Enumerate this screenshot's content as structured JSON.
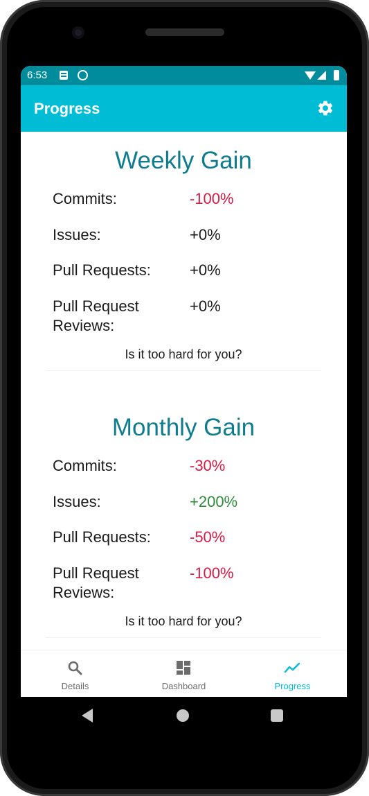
{
  "status_bar": {
    "time": "6:53"
  },
  "app_bar": {
    "title": "Progress"
  },
  "weekly": {
    "title": "Weekly Gain",
    "rows": [
      {
        "label": "Commits:",
        "value": "-100%",
        "trend": "neg"
      },
      {
        "label": "Issues:",
        "value": "+0%",
        "trend": "neutral"
      },
      {
        "label": "Pull Requests:",
        "value": "+0%",
        "trend": "neutral"
      },
      {
        "label": "Pull Request Reviews:",
        "value": "+0%",
        "trend": "neutral"
      }
    ],
    "footer": "Is it too hard for you?"
  },
  "monthly": {
    "title": "Monthly Gain",
    "rows": [
      {
        "label": "Commits:",
        "value": "-30%",
        "trend": "neg"
      },
      {
        "label": "Issues:",
        "value": "+200%",
        "trend": "pos"
      },
      {
        "label": "Pull Requests:",
        "value": "-50%",
        "trend": "neg"
      },
      {
        "label": "Pull Request Reviews:",
        "value": "-100%",
        "trend": "neg"
      }
    ],
    "footer": "Is it too hard for you?"
  },
  "bottom_nav": {
    "items": [
      {
        "label": "Details",
        "icon": "search-icon",
        "active": false
      },
      {
        "label": "Dashboard",
        "icon": "dashboard-icon",
        "active": false
      },
      {
        "label": "Progress",
        "icon": "trending-icon",
        "active": true
      }
    ]
  },
  "colors": {
    "status_bar": "#008c9c",
    "app_bar": "#00bcd4",
    "title": "#0f7b8e",
    "negative": "#d81b45",
    "positive": "#2e8b3a"
  }
}
